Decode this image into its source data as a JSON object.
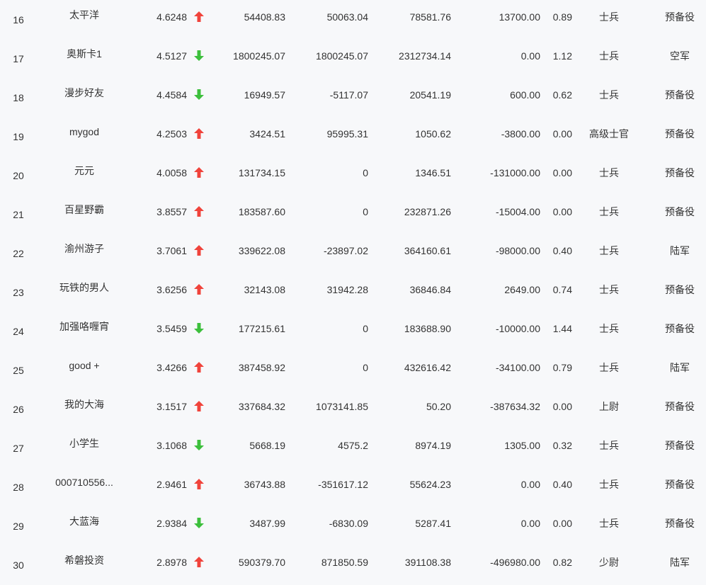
{
  "colors": {
    "up": "#f0433b",
    "down": "#3cbf3c",
    "text": "#333333",
    "background": "#f7f8fa"
  },
  "rows": [
    {
      "rank": "16",
      "name": "太平洋",
      "score": "4.6248",
      "trend": "up",
      "v1": "54408.83",
      "v2": "50063.04",
      "v3": "78581.76",
      "v4": "13700.00",
      "ratio": "0.89",
      "title": "士兵",
      "unit": "预备役"
    },
    {
      "rank": "17",
      "name": "奥斯卡1",
      "score": "4.5127",
      "trend": "down",
      "v1": "1800245.07",
      "v2": "1800245.07",
      "v3": "2312734.14",
      "v4": "0.00",
      "ratio": "1.12",
      "title": "士兵",
      "unit": "空军"
    },
    {
      "rank": "18",
      "name": "漫步好友",
      "score": "4.4584",
      "trend": "down",
      "v1": "16949.57",
      "v2": "-5117.07",
      "v3": "20541.19",
      "v4": "600.00",
      "ratio": "0.62",
      "title": "士兵",
      "unit": "预备役"
    },
    {
      "rank": "19",
      "name": "mygod",
      "score": "4.2503",
      "trend": "up",
      "v1": "3424.51",
      "v2": "95995.31",
      "v3": "1050.62",
      "v4": "-3800.00",
      "ratio": "0.00",
      "title": "高级士官",
      "unit": "预备役"
    },
    {
      "rank": "20",
      "name": "元元",
      "score": "4.0058",
      "trend": "up",
      "v1": "131734.15",
      "v2": "0",
      "v3": "1346.51",
      "v4": "-131000.00",
      "ratio": "0.00",
      "title": "士兵",
      "unit": "预备役"
    },
    {
      "rank": "21",
      "name": "百星野霸",
      "score": "3.8557",
      "trend": "up",
      "v1": "183587.60",
      "v2": "0",
      "v3": "232871.26",
      "v4": "-15004.00",
      "ratio": "0.00",
      "title": "士兵",
      "unit": "预备役"
    },
    {
      "rank": "22",
      "name": "渝州游子",
      "score": "3.7061",
      "trend": "up",
      "v1": "339622.08",
      "v2": "-23897.02",
      "v3": "364160.61",
      "v4": "-98000.00",
      "ratio": "0.40",
      "title": "士兵",
      "unit": "陆军"
    },
    {
      "rank": "23",
      "name": "玩铁的男人",
      "score": "3.6256",
      "trend": "up",
      "v1": "32143.08",
      "v2": "31942.28",
      "v3": "36846.84",
      "v4": "2649.00",
      "ratio": "0.74",
      "title": "士兵",
      "unit": "预备役"
    },
    {
      "rank": "24",
      "name": "加强咯喱宵",
      "score": "3.5459",
      "trend": "down",
      "v1": "177215.61",
      "v2": "0",
      "v3": "183688.90",
      "v4": "-10000.00",
      "ratio": "1.44",
      "title": "士兵",
      "unit": "预备役"
    },
    {
      "rank": "25",
      "name": "good +",
      "score": "3.4266",
      "trend": "up",
      "v1": "387458.92",
      "v2": "0",
      "v3": "432616.42",
      "v4": "-34100.00",
      "ratio": "0.79",
      "title": "士兵",
      "unit": "陆军"
    },
    {
      "rank": "26",
      "name": "我的大海",
      "score": "3.1517",
      "trend": "up",
      "v1": "337684.32",
      "v2": "1073141.85",
      "v3": "50.20",
      "v4": "-387634.32",
      "ratio": "0.00",
      "title": "上尉",
      "unit": "预备役"
    },
    {
      "rank": "27",
      "name": "小学生",
      "score": "3.1068",
      "trend": "down",
      "v1": "5668.19",
      "v2": "4575.2",
      "v3": "8974.19",
      "v4": "1305.00",
      "ratio": "0.32",
      "title": "士兵",
      "unit": "预备役"
    },
    {
      "rank": "28",
      "name": "000710556...",
      "score": "2.9461",
      "trend": "up",
      "v1": "36743.88",
      "v2": "-351617.12",
      "v3": "55624.23",
      "v4": "0.00",
      "ratio": "0.40",
      "title": "士兵",
      "unit": "预备役"
    },
    {
      "rank": "29",
      "name": "大蓝海",
      "score": "2.9384",
      "trend": "down",
      "v1": "3487.99",
      "v2": "-6830.09",
      "v3": "5287.41",
      "v4": "0.00",
      "ratio": "0.00",
      "title": "士兵",
      "unit": "预备役"
    },
    {
      "rank": "30",
      "name": "希磐投资",
      "score": "2.8978",
      "trend": "up",
      "v1": "590379.70",
      "v2": "871850.59",
      "v3": "391108.38",
      "v4": "-496980.00",
      "ratio": "0.82",
      "title": "少尉",
      "unit": "陆军"
    }
  ]
}
